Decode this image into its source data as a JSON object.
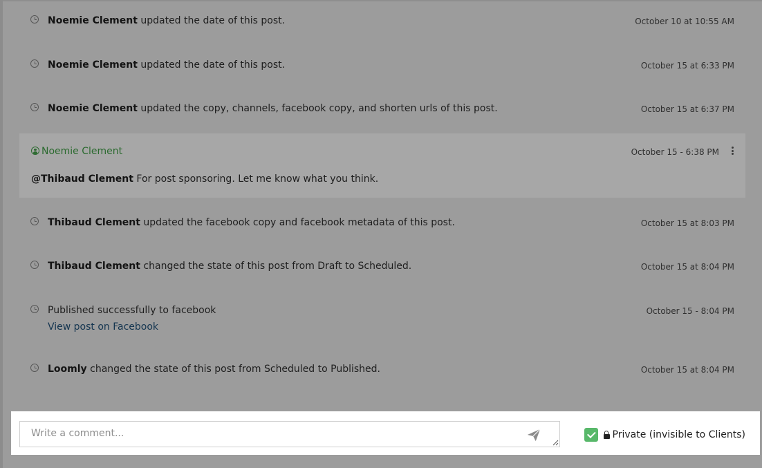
{
  "activity": [
    {
      "actor": "Noemie Clement",
      "text": " updated the date of this post.",
      "time": "October 10 at 10:55 AM"
    },
    {
      "actor": "Noemie Clement",
      "text": " updated the date of this post.",
      "time": "October 15 at 6:33 PM"
    },
    {
      "actor": "Noemie Clement",
      "text": " updated the copy, channels, facebook copy, and shorten urls of this post.",
      "time": "October 15 at 6:37 PM"
    }
  ],
  "comment": {
    "author": "Noemie Clement",
    "time": "October 15 - 6:38 PM",
    "mention": "@Thibaud Clement",
    "body": " For post sponsoring. Let me know what you think."
  },
  "activity_after": [
    {
      "actor": "Thibaud Clement",
      "text": " updated the facebook copy and facebook metadata of this post.",
      "time": "October 15 at 8:03 PM"
    },
    {
      "actor": "Thibaud Clement",
      "text": " changed the state of this post from Draft to Scheduled.",
      "time": "October 15 at 8:04 PM"
    }
  ],
  "publish": {
    "text": "Published successfully to facebook",
    "link": "View post on Facebook",
    "time": "October 15 - 8:04 PM"
  },
  "final": {
    "actor": "Loomly",
    "text": " changed the state of this post from Scheduled to Published.",
    "time": "October 15 at 8:04 PM"
  },
  "compose": {
    "placeholder": "Write a comment...",
    "private_label": "Private (invisible to Clients)",
    "private_checked": true
  },
  "icons": {
    "activity": "clock-icon",
    "author": "user-circle-icon",
    "menu": "kebab-menu-icon",
    "send": "paper-plane-icon",
    "lock": "lock-icon"
  },
  "colors": {
    "overlay_bg": "#9c9c9c",
    "comment_author": "#2b6a2f",
    "link": "#143550",
    "checkbox": "#58b86a"
  }
}
